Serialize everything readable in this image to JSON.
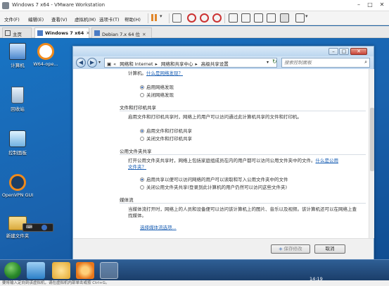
{
  "vmware": {
    "title": "Windows 7 x64 - VMware Workstation",
    "menu": [
      "文件(F)",
      "编辑(E)",
      "查看(V)",
      "虚拟机(M)",
      "选项卡(T)",
      "帮助(H)"
    ],
    "tabs": [
      {
        "label": "主页",
        "icon": "home-icon"
      },
      {
        "label": "Windows 7 x64",
        "icon": "vm-icon",
        "active": true
      },
      {
        "label": "Debian 7.x 64 位",
        "icon": "vm-icon"
      }
    ],
    "status_text": "要将输入定向到该虚拟机，请在虚拟机内部单击或按 Ctrl+G。"
  },
  "desktop": {
    "icons": [
      {
        "label": "计算机",
        "icon": "computer-icon"
      },
      {
        "label": "W64-ope...",
        "icon": "openvpn-icon"
      },
      {
        "label": "回收站",
        "icon": "recycle-bin-icon"
      },
      {
        "label": "控制面板",
        "icon": "control-panel-icon"
      },
      {
        "label": "OpenVPN GUI",
        "icon": "openvpn-icon"
      },
      {
        "label": "新建文件夹",
        "icon": "folder-icon"
      }
    ]
  },
  "explorer": {
    "breadcrumb": [
      "网络和 Internet",
      "网络和共享中心",
      "高级共享设置"
    ],
    "search_placeholder": "搜索控制面板",
    "top_text": "计算机。",
    "top_link": "什么是网络发现？",
    "top_options": [
      {
        "label": "启用网络发现",
        "selected": true
      },
      {
        "label": "关闭网络发现",
        "selected": false
      }
    ],
    "sections": [
      {
        "heading": "文件和打印机共享",
        "desc": "启用文件和打印机共享时，网络上的用户可以访问通过此计算机共享的文件和打印机。",
        "options": [
          {
            "label": "启用文件和打印机共享",
            "selected": true
          },
          {
            "label": "关闭文件和打印机共享",
            "selected": false
          }
        ]
      },
      {
        "heading": "公用文件夹共享",
        "desc": "打开公用文件夹共享时，网络上包括家庭组成员在内的用户都可以访问公用文件夹中的文件。",
        "link": "什么是公用文件夹？",
        "options": [
          {
            "label": "启用共享以便可以访问网络的用户可以读取和写入公用文件夹中的文件",
            "selected": true
          },
          {
            "label": "关闭公用文件夹共享(登录到此计算机的用户仍然可以访问这些文件夹)",
            "selected": false
          }
        ]
      },
      {
        "heading": "媒体流",
        "desc": "当媒体流打开时，网络上的人员和设备便可以访问该计算机上的图片、音乐以及视频。该计算机还可以在网络上查找媒体。",
        "link": "选择媒体流选项..."
      }
    ],
    "save_label": "保存修改",
    "cancel_label": "取消"
  },
  "taskbar": {
    "pins": [
      "explorer-icon",
      "ie-icon",
      "library-icon",
      "media-player-icon",
      "control-panel-icon"
    ],
    "time": "14:19"
  }
}
